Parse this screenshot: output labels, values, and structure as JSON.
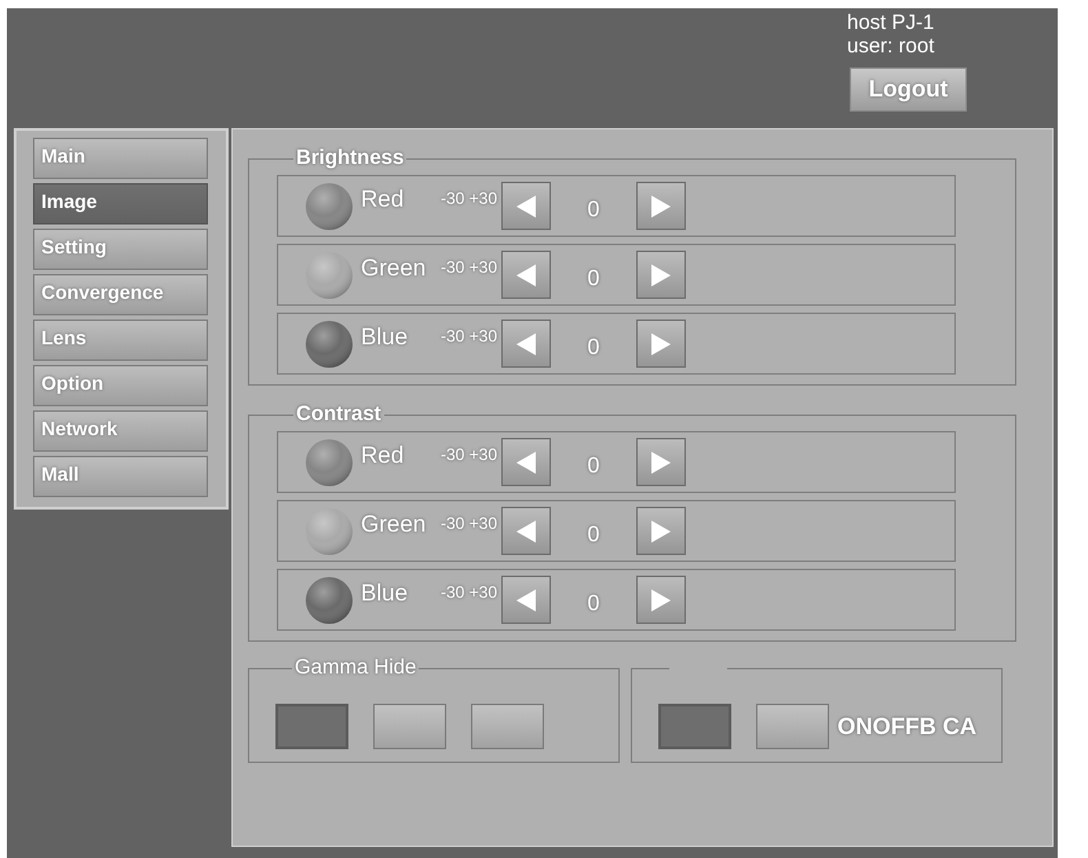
{
  "header": {
    "host": "host PJ-1",
    "user": "user: root",
    "logout": "Logout"
  },
  "sidebar": {
    "items": [
      {
        "label": "Main",
        "selected": false
      },
      {
        "label": "Image",
        "selected": true
      },
      {
        "label": "Setting",
        "selected": false
      },
      {
        "label": "Convergence",
        "selected": false
      },
      {
        "label": "Lens",
        "selected": false
      },
      {
        "label": "Option",
        "selected": false
      },
      {
        "label": "Network",
        "selected": false
      },
      {
        "label": "Mall",
        "selected": false
      }
    ]
  },
  "sections": [
    {
      "title": "Brightness",
      "channels": [
        {
          "name": "Red",
          "color": "#858585",
          "range": "-30 +30",
          "value": "0"
        },
        {
          "name": "Green",
          "color": "#a9a9a9",
          "range": "-30 +30",
          "value": "0"
        },
        {
          "name": "Blue",
          "color": "#6a6a6a",
          "range": "-30 +30",
          "value": "0"
        }
      ]
    },
    {
      "title": "Contrast",
      "channels": [
        {
          "name": "Red",
          "color": "#858585",
          "range": "-30 +30",
          "value": "0"
        },
        {
          "name": "Green",
          "color": "#a9a9a9",
          "range": "-30 +30",
          "value": "0"
        },
        {
          "name": "Blue",
          "color": "#6a6a6a",
          "range": "-30 +30",
          "value": "0"
        }
      ]
    }
  ],
  "gamma_hide": {
    "title": "Gamma Hide",
    "options": [
      {
        "selected": true
      },
      {
        "selected": false
      },
      {
        "selected": false
      }
    ]
  },
  "group_2": {
    "options": [
      {
        "selected": true
      },
      {
        "selected": false
      }
    ],
    "caption": "ONOFFB CA"
  }
}
